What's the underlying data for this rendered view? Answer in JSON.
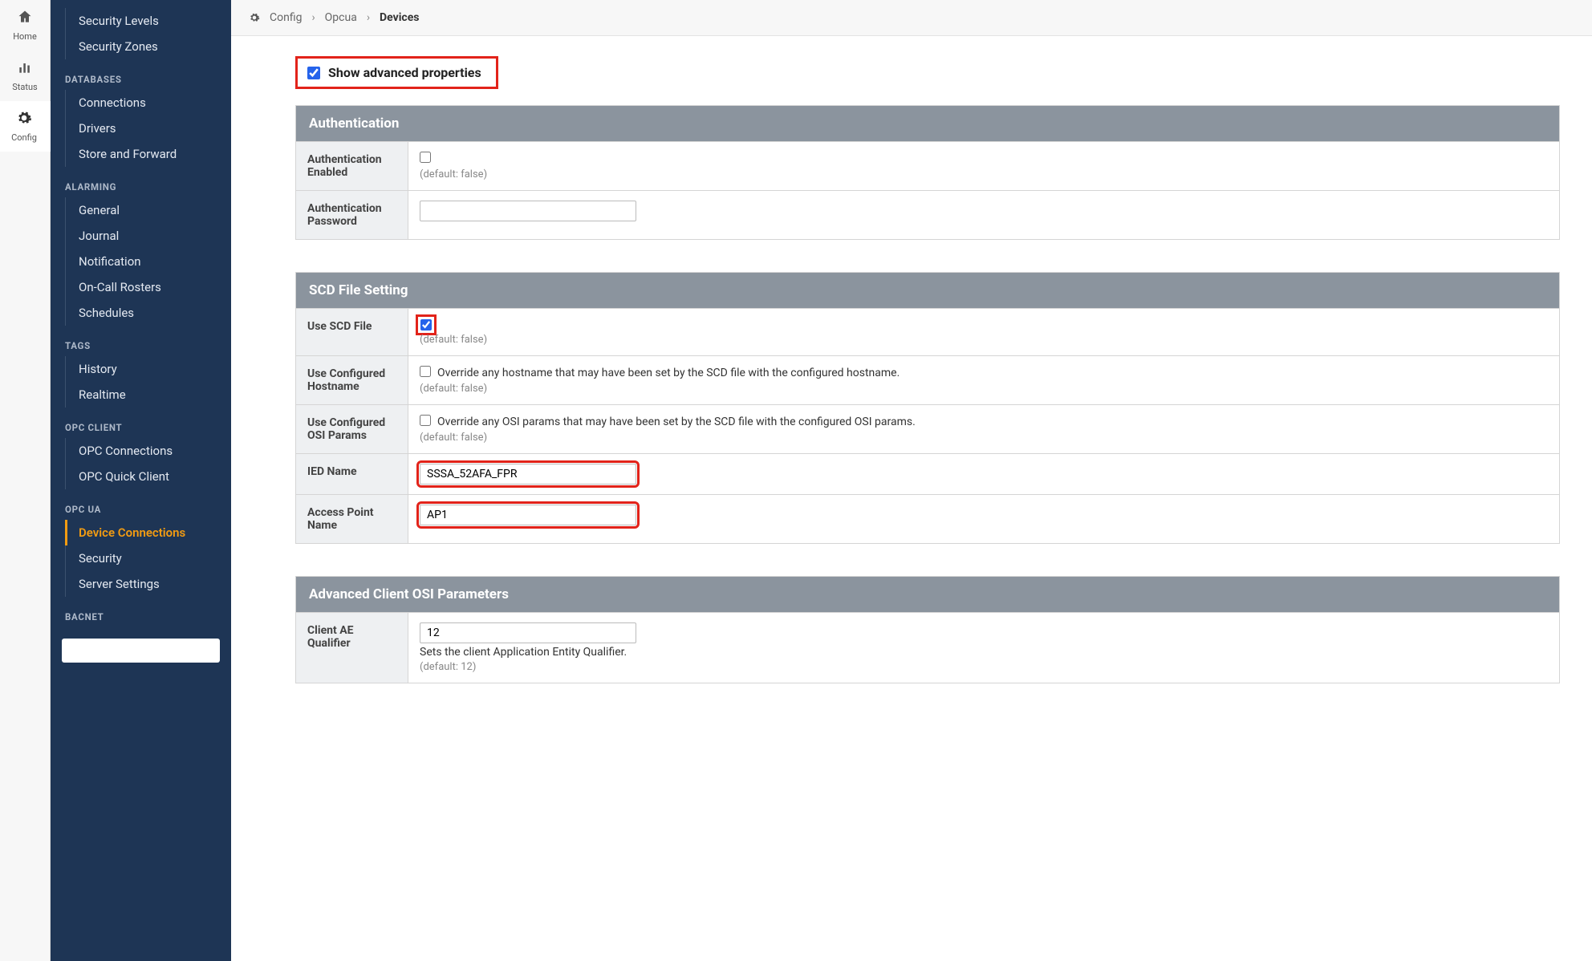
{
  "rail": {
    "home": "Home",
    "status": "Status",
    "config": "Config"
  },
  "sidebar": {
    "topItems": [
      "Security Levels",
      "Security Zones"
    ],
    "groups": [
      {
        "header": "DATABASES",
        "items": [
          "Connections",
          "Drivers",
          "Store and Forward"
        ]
      },
      {
        "header": "ALARMING",
        "items": [
          "General",
          "Journal",
          "Notification",
          "On-Call Rosters",
          "Schedules"
        ]
      },
      {
        "header": "TAGS",
        "items": [
          "History",
          "Realtime"
        ]
      },
      {
        "header": "OPC CLIENT",
        "items": [
          "OPC Connections",
          "OPC Quick Client"
        ]
      },
      {
        "header": "OPC UA",
        "items": [
          "Device Connections",
          "Security",
          "Server Settings"
        ],
        "activeIndex": 0
      },
      {
        "header": "BACNET",
        "items": []
      }
    ]
  },
  "breadcrumb": {
    "root": "Config",
    "mid": "Opcua",
    "current": "Devices"
  },
  "advanced": {
    "label": "Show advanced properties",
    "checked": true
  },
  "sections": [
    {
      "title": "Authentication",
      "fields": [
        {
          "label": "Authentication Enabled",
          "type": "checkbox",
          "checked": false,
          "default": "(default: false)"
        },
        {
          "label": "Authentication Password",
          "type": "text",
          "value": ""
        }
      ]
    },
    {
      "title": "SCD File Setting",
      "fields": [
        {
          "label": "Use SCD File",
          "type": "checkbox",
          "checked": true,
          "default": "(default: false)",
          "highlight": true
        },
        {
          "label": "Use Configured Hostname",
          "type": "checkbox",
          "checked": false,
          "inlineText": "Override any hostname that may have been set by the SCD file with the configured hostname.",
          "default": "(default: false)"
        },
        {
          "label": "Use Configured OSI Params",
          "type": "checkbox",
          "checked": false,
          "inlineText": "Override any OSI params that may have been set by the SCD file with the configured OSI params.",
          "default": "(default: false)"
        },
        {
          "label": "IED Name",
          "type": "text",
          "value": "SSSA_52AFA_FPR",
          "highlight": true
        },
        {
          "label": "Access Point Name",
          "type": "text",
          "value": "AP1",
          "highlight": true
        }
      ]
    },
    {
      "title": "Advanced Client OSI Parameters",
      "fields": [
        {
          "label": "Client AE Qualifier",
          "type": "text",
          "value": "12",
          "helper": "Sets the client Application Entity Qualifier.",
          "default": "(default: 12)"
        }
      ]
    }
  ]
}
